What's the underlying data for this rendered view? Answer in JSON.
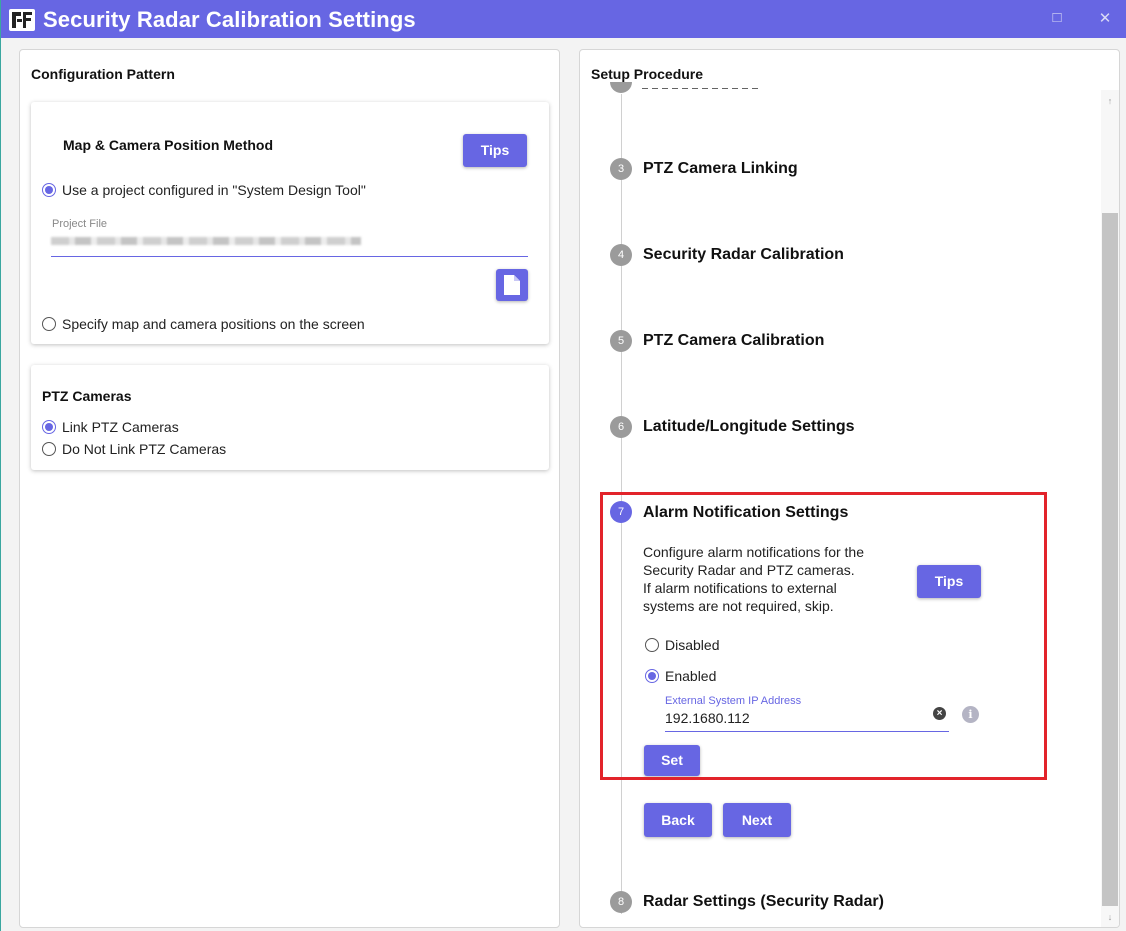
{
  "window": {
    "title": "Security Radar Calibration Settings",
    "maximize_glyph": "□",
    "close_glyph": "✕",
    "accent_color": "#6766e3"
  },
  "left_panel": {
    "title": "Configuration Pattern",
    "map_card": {
      "heading": "Map & Camera Position Method",
      "tips_label": "Tips",
      "option_project": "Use a project configured in \"System Design Tool\"",
      "project_file_label": "Project File",
      "option_screen": "Specify map and camera positions on the screen",
      "selected": "project",
      "file_button_icon": "file-icon"
    },
    "ptz_card": {
      "heading": "PTZ Cameras",
      "option_link": "Link PTZ Cameras",
      "option_no_link": "Do Not Link PTZ Cameras",
      "selected": "link"
    }
  },
  "right_panel": {
    "title": "Setup Procedure",
    "steps": [
      {
        "number": "3",
        "title": "PTZ Camera Linking"
      },
      {
        "number": "4",
        "title": "Security Radar Calibration"
      },
      {
        "number": "5",
        "title": "PTZ Camera Calibration"
      },
      {
        "number": "6",
        "title": "Latitude/Longitude Settings"
      },
      {
        "number": "7",
        "title": "Alarm Notification Settings"
      },
      {
        "number": "8",
        "title": "Radar Settings (Security Radar)"
      }
    ],
    "alarm": {
      "desc_lines": [
        "Configure alarm notifications for the",
        "Security Radar and PTZ cameras.",
        "If alarm notifications to external",
        "systems are not required, skip."
      ],
      "tips_label": "Tips",
      "option_disabled": "Disabled",
      "option_enabled": "Enabled",
      "selected": "enabled",
      "ip_label": "External System IP Address",
      "ip_value": "192.1680.112",
      "set_label": "Set"
    },
    "nav": {
      "back_label": "Back",
      "next_label": "Next"
    },
    "scroll_up_glyph": "↑",
    "scroll_down_glyph": "↓",
    "highlight_color": "#e2232a"
  }
}
